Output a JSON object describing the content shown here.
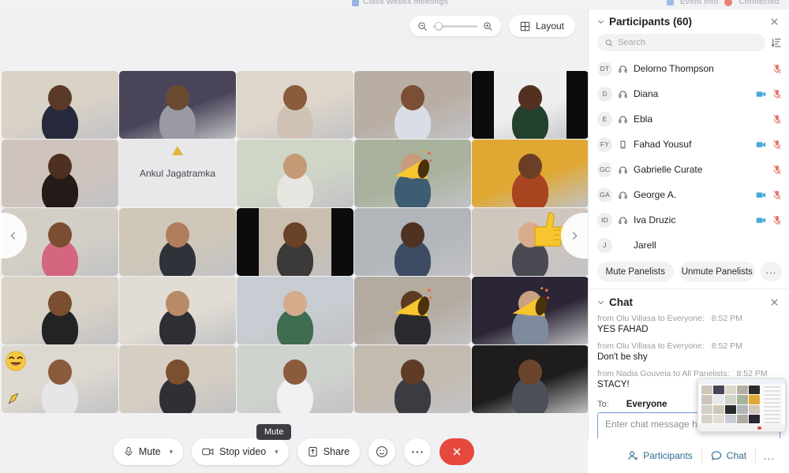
{
  "app": {
    "window_title": "Class Webex meetings",
    "status_event_info": "Event Info",
    "status_connected": "Connected"
  },
  "stage_header": {
    "zoom_out_icon": "zoom-out-icon",
    "zoom_in_icon": "zoom-in-icon",
    "layout_label": "Layout",
    "layout_icon": "grid-icon"
  },
  "grid": {
    "prev_icon": "chevron-left-icon",
    "next_icon": "chevron-right-icon",
    "placeholder_name": "Ankul Jagatramka",
    "tiles": [
      {
        "id": "tile-1",
        "bg": "#d9d2c7",
        "skin": "#5a3a26",
        "shirt": "#262a3c",
        "reaction": ""
      },
      {
        "id": "tile-2",
        "bg": "#4a4459",
        "skin": "#6b4a32",
        "shirt": "#9a9aa4",
        "reaction": ""
      },
      {
        "id": "tile-3",
        "bg": "#ded5cb",
        "skin": "#8a5b3c",
        "shirt": "#cfc2b4",
        "reaction": ""
      },
      {
        "id": "tile-4",
        "bg": "#b9aea4",
        "skin": "#7a4f33",
        "shirt": "#d8dde6",
        "reaction": ""
      },
      {
        "id": "tile-5",
        "bg": "#efefef",
        "skin": "#53301f",
        "shirt": "#22402e",
        "reaction": "",
        "letterbox": true
      },
      {
        "id": "tile-6",
        "bg": "#cfc4bd",
        "skin": "#4e3020",
        "shirt": "#241b18",
        "reaction": ""
      },
      {
        "id": "tile-7",
        "bg": "#e8e8ea",
        "placeholder": true
      },
      {
        "id": "tile-8",
        "bg": "#cfd6c6",
        "skin": "#c49a76",
        "shirt": "#e8e6e0",
        "reaction": ""
      },
      {
        "id": "tile-9",
        "bg": "#a8b29c",
        "skin": "#c79b7c",
        "shirt": "#3f5d72",
        "reaction": "clap"
      },
      {
        "id": "tile-10",
        "bg": "#e0a832",
        "skin": "#6b3f26",
        "shirt": "#a8441f",
        "reaction": ""
      },
      {
        "id": "tile-11",
        "bg": "#d3cfc6",
        "skin": "#7b4d33",
        "shirt": "#d4677f",
        "reaction": ""
      },
      {
        "id": "tile-12",
        "bg": "#cfc7b8",
        "skin": "#b07e5c",
        "shirt": "#30323a",
        "reaction": ""
      },
      {
        "id": "tile-13",
        "bg": "#c9beb0",
        "skin": "#6a4228",
        "shirt": "#3c3a38",
        "reaction": "",
        "letterbox": true
      },
      {
        "id": "tile-14",
        "bg": "#b2b6bb",
        "skin": "#4f3322",
        "shirt": "#3d4b63",
        "reaction": ""
      },
      {
        "id": "tile-15",
        "bg": "#cfc6bd",
        "skin": "#d8ac8c",
        "shirt": "#4a4a52",
        "reaction": "thumb"
      },
      {
        "id": "tile-16",
        "bg": "#d9d2c6",
        "skin": "#7a4e31",
        "shirt": "#232326",
        "reaction": ""
      },
      {
        "id": "tile-17",
        "bg": "#e2ddd4",
        "skin": "#b88a66",
        "shirt": "#2d2f34",
        "reaction": ""
      },
      {
        "id": "tile-18",
        "bg": "#c7cdd2",
        "skin": "#d6ab8c",
        "shirt": "#3f6d4f",
        "reaction": ""
      },
      {
        "id": "tile-19",
        "bg": "#b4aba0",
        "skin": "#5d3a24",
        "shirt": "#2a2a2e",
        "reaction": "clap"
      },
      {
        "id": "tile-20",
        "bg": "#2b2535",
        "skin": "#c9a183",
        "shirt": "#7e8b9c",
        "reaction": "clap"
      },
      {
        "id": "tile-21",
        "bg": "#ddd8d0",
        "skin": "#8a5a3a",
        "shirt": "#e6e6e8",
        "reaction": ""
      },
      {
        "id": "tile-22",
        "bg": "#d6cec2",
        "skin": "#7d4f31",
        "shirt": "#2e3035",
        "reaction": ""
      },
      {
        "id": "tile-23",
        "bg": "#cfd3cd",
        "skin": "#8a5c3c",
        "shirt": "#f0f0f0",
        "reaction": ""
      },
      {
        "id": "tile-24",
        "bg": "#c4bbb0",
        "skin": "#5e3c26",
        "shirt": "#3a3c42",
        "reaction": ""
      },
      {
        "id": "tile-25",
        "bg": "#1f1d1c",
        "skin": "#6a452c",
        "shirt": "#4a4f58",
        "reaction": ""
      }
    ],
    "floating_reactions": [
      "joy-emoji",
      "thumbs-up-emoji"
    ]
  },
  "controls": {
    "tooltip": "Mute",
    "mute_label": "Mute",
    "mute_icon": "microphone-icon",
    "stop_video_label": "Stop video",
    "stop_video_icon": "camera-icon",
    "share_label": "Share",
    "share_icon": "share-up-icon",
    "reaction_icon": "smiley-icon",
    "more_icon": "more-horizontal-icon",
    "end_icon": "close-x-icon"
  },
  "participants_panel": {
    "collapse_icon": "chevron-down-icon",
    "title": "Participants (60)",
    "close_icon": "close-icon",
    "search_icon": "search-icon",
    "search_placeholder": "Search",
    "search_value": "",
    "sort_icon": "sort-list-icon",
    "items": [
      {
        "initials": "DT",
        "name": "Delorno Thompson",
        "device": "headset",
        "video": false,
        "muted": true
      },
      {
        "initials": "D",
        "name": "Diana",
        "device": "headset",
        "video": true,
        "muted": true
      },
      {
        "initials": "E",
        "name": "Ebla",
        "device": "headset",
        "video": false,
        "muted": true
      },
      {
        "initials": "FY",
        "name": "Fahad Yousuf",
        "device": "phone",
        "video": true,
        "muted": true
      },
      {
        "initials": "GC",
        "name": "Gabrielle Curate",
        "device": "headset",
        "video": false,
        "muted": true
      },
      {
        "initials": "GA",
        "name": "George A.",
        "device": "headset",
        "video": true,
        "muted": true
      },
      {
        "initials": "ID",
        "name": "Iva Druzic",
        "device": "headset",
        "video": true,
        "muted": true
      },
      {
        "initials": "J",
        "name": "Jarell",
        "device": "none",
        "video": false,
        "muted": false
      }
    ],
    "mute_panelists_label": "Mute Panelists",
    "unmute_panelists_label": "Unmute Panelists",
    "more_label": "..."
  },
  "chat_panel": {
    "collapse_icon": "chevron-down-icon",
    "title": "Chat",
    "close_icon": "close-icon",
    "messages": [
      {
        "from": "from Olu Villasa to Everyone:",
        "time": "8:52  PM",
        "text": "YES FAHAD"
      },
      {
        "from": "from Olu Villasa to Everyone:",
        "time": "8:52  PM",
        "text": "Don't be shy"
      },
      {
        "from": "from Nadia Gouveia to All Panelists:",
        "time": "8:52  PM",
        "text": "STACY!"
      }
    ],
    "to_label": "To:",
    "to_value": "Everyone",
    "input_placeholder": "Enter chat message here",
    "input_value": ""
  },
  "panel_tabs": {
    "participants_label": "Participants",
    "participants_icon": "person-icon",
    "chat_label": "Chat",
    "chat_icon": "chat-bubble-icon",
    "more_label": "..."
  },
  "pip": {
    "label": "meeting-thumbnail-preview"
  },
  "colors": {
    "accent_blue": "#2e6b8f",
    "muted_red": "#e3796c",
    "video_blue": "#4aa8d8",
    "end_call_red": "#e6483d",
    "panel_bg": "#ffffff",
    "stage_bg": "#f1f1f3"
  }
}
